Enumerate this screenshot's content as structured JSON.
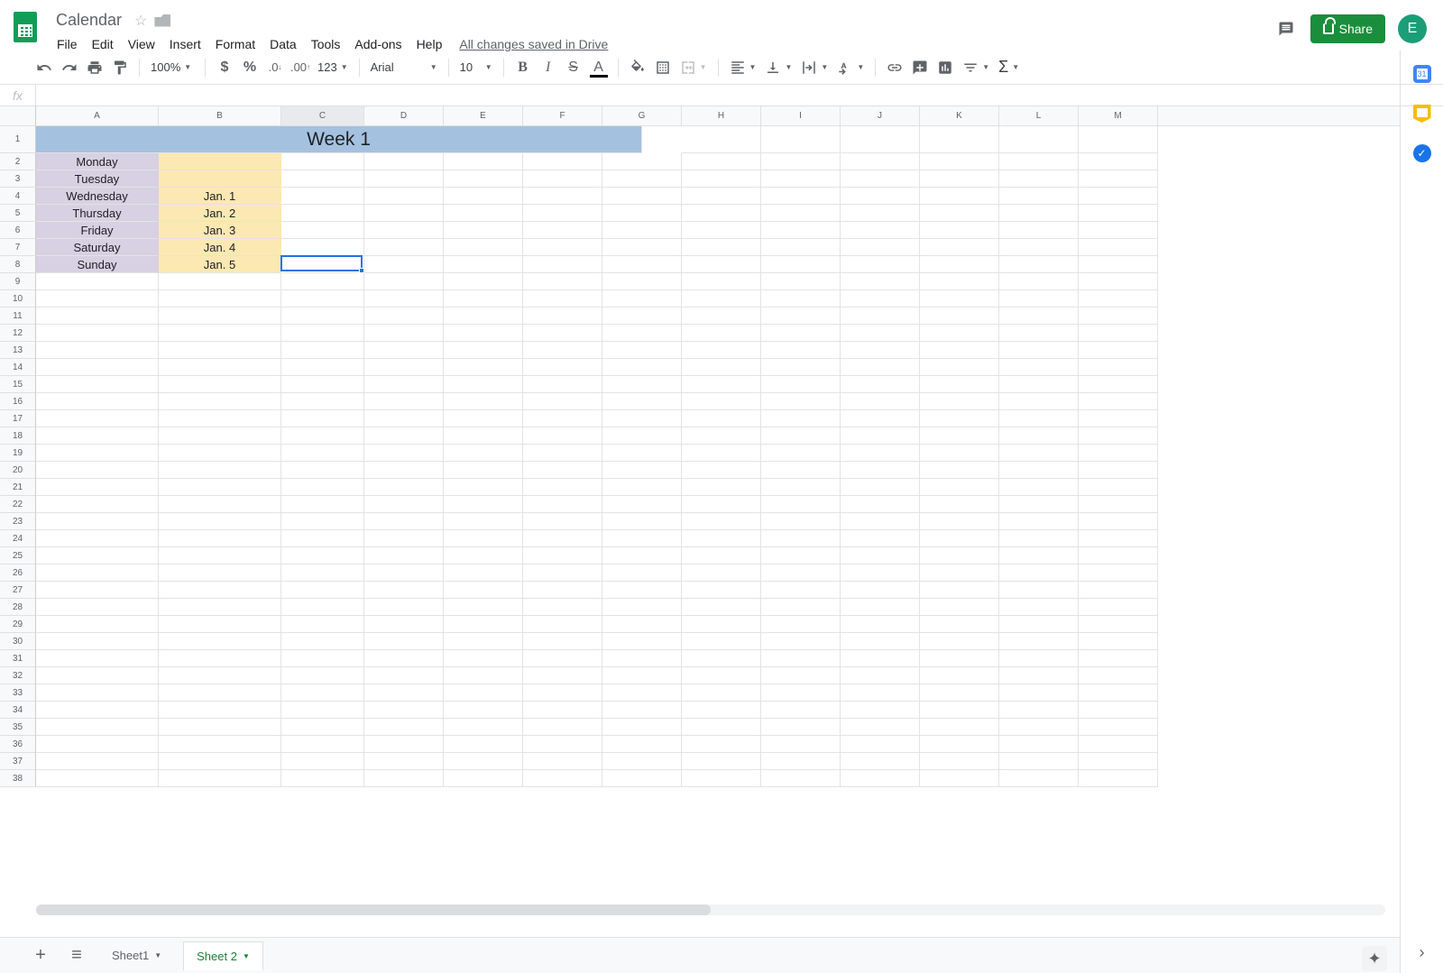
{
  "header": {
    "title": "Calendar",
    "save_status": "All changes saved in Drive",
    "share_label": "Share",
    "avatar_letter": "E"
  },
  "menu": {
    "items": [
      "File",
      "Edit",
      "View",
      "Insert",
      "Format",
      "Data",
      "Tools",
      "Add-ons",
      "Help"
    ]
  },
  "toolbar": {
    "zoom": "100%",
    "font": "Arial",
    "font_size": "10",
    "number_format": "123"
  },
  "formula_bar": {
    "fx": "fx",
    "value": ""
  },
  "columns": [
    "A",
    "B",
    "C",
    "D",
    "E",
    "F",
    "G",
    "H",
    "I",
    "J",
    "K",
    "L",
    "M"
  ],
  "rows": {
    "count": 38
  },
  "content": {
    "week_title": "Week 1",
    "days": [
      {
        "name": "Monday",
        "date": ""
      },
      {
        "name": "Tuesday",
        "date": ""
      },
      {
        "name": "Wednesday",
        "date": "Jan. 1"
      },
      {
        "name": "Thursday",
        "date": "Jan. 2"
      },
      {
        "name": "Friday",
        "date": "Jan. 3"
      },
      {
        "name": "Saturday",
        "date": "Jan. 4"
      },
      {
        "name": "Sunday",
        "date": "Jan. 5"
      }
    ]
  },
  "selection": {
    "cell": "C8"
  },
  "sheets": {
    "tabs": [
      {
        "name": "Sheet1",
        "active": false
      },
      {
        "name": "Sheet 2",
        "active": true
      }
    ]
  }
}
